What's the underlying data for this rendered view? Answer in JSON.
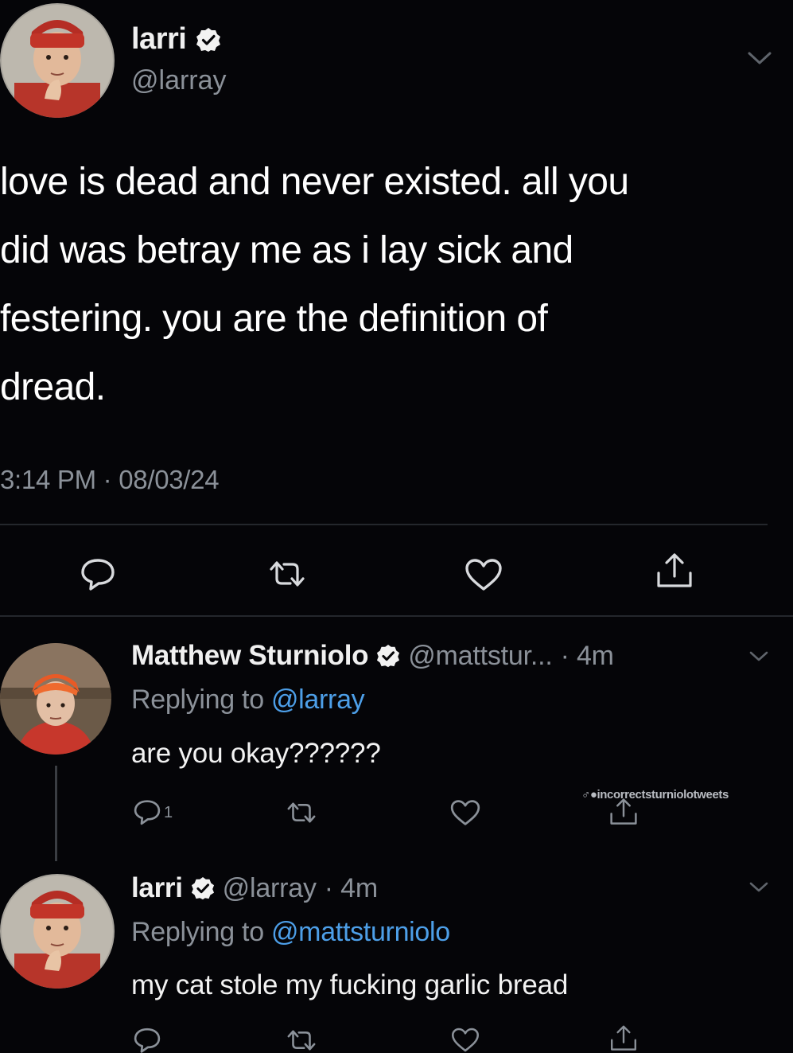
{
  "main_tweet": {
    "author_name": "larri",
    "author_handle": "@larray",
    "body_lines": [
      "love is dead and never existed. all you",
      "did was betray me as i lay sick and",
      "festering. you are the definition of",
      "dread."
    ],
    "timestamp": "3:14 PM · 08/03/24",
    "icons": [
      "reply-icon",
      "retweet-icon",
      "like-icon",
      "share-icon",
      "chevron-down-icon",
      "verified-badge-icon"
    ]
  },
  "replies": [
    {
      "author_name": "Matthew Sturniolo",
      "author_handle": "@mattstur...",
      "time": "· 4m",
      "replying_prefix": "Replying to ",
      "replying_to": "@larray",
      "text": "are you okay??????",
      "reply_count": "1"
    },
    {
      "author_name": "larri",
      "author_handle": "@larray",
      "time": "· 4m",
      "replying_prefix": "Replying to ",
      "replying_to": "@mattsturniolo",
      "text": "my cat stole my fucking garlic bread"
    }
  ],
  "watermark": "♂●incorrectsturniolotweets",
  "colors": {
    "background": "#050508",
    "text": "#ffffff",
    "secondary": "#8b9199",
    "link": "#4d9fe8",
    "divider": "#24272c"
  }
}
